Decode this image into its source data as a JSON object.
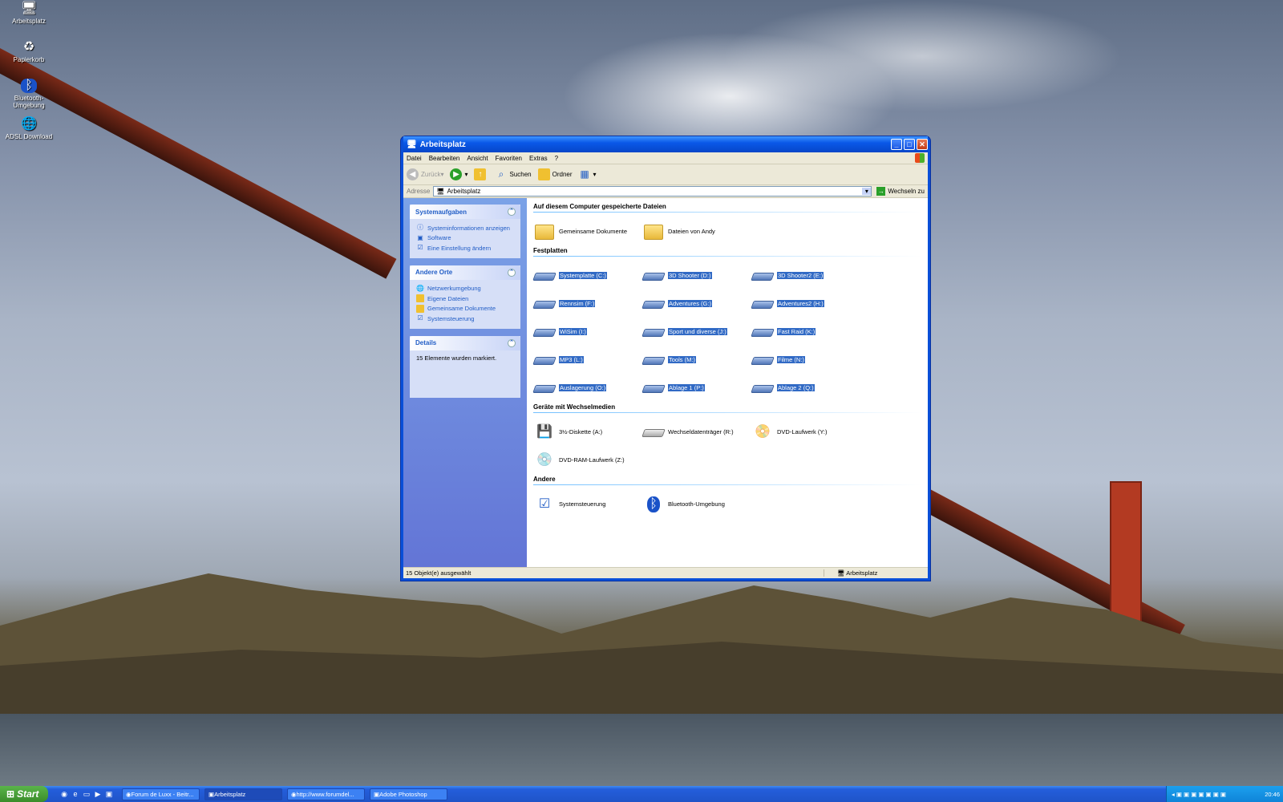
{
  "desktop": {
    "icons": [
      {
        "label": "Arbeitsplatz",
        "icon": "computer-icon"
      },
      {
        "label": "Papierkorb",
        "icon": "recycle-bin-icon"
      },
      {
        "label": "Bluetooth-Umgebung",
        "icon": "bluetooth-icon"
      },
      {
        "label": "ADSL Download",
        "icon": "network-icon"
      }
    ]
  },
  "window": {
    "title": "Arbeitsplatz",
    "menu": [
      "Datei",
      "Bearbeiten",
      "Ansicht",
      "Favoriten",
      "Extras",
      "?"
    ],
    "toolbar": {
      "back": "Zurück",
      "search": "Suchen",
      "folders": "Ordner"
    },
    "address": {
      "label": "Adresse",
      "value": "Arbeitsplatz",
      "go": "Wechseln zu"
    },
    "tasks": {
      "system": {
        "title": "Systemaufgaben",
        "links": [
          "Systeminformationen anzeigen",
          "Software",
          "Eine Einstellung ändern"
        ]
      },
      "other": {
        "title": "Andere Orte",
        "links": [
          "Netzwerkumgebung",
          "Eigene Dateien",
          "Gemeinsame Dokumente",
          "Systemsteuerung"
        ]
      },
      "details": {
        "title": "Details",
        "text": "15 Elemente wurden markiert."
      }
    },
    "groups": {
      "files": {
        "title": "Auf diesem Computer gespeicherte Dateien",
        "items": [
          "Gemeinsame Dokumente",
          "Dateien von Andy"
        ]
      },
      "drives": {
        "title": "Festplatten",
        "items": [
          "Systemplatte (C:)",
          "3D Shooter (D:)",
          "3D Shooter2 (E:)",
          "Rennsim (F:)",
          "Adventures (G:)",
          "Adventures2 (H:)",
          "WiSim (I:)",
          "Sport und diverse (J:)",
          "Fast Raid (K:)",
          "MP3 (L:)",
          "Tools (M:)",
          "Filme (N:)",
          "Auslagerung (O:)",
          "Ablage 1 (P:)",
          "Ablage 2 (Q:)"
        ]
      },
      "removable": {
        "title": "Geräte mit Wechselmedien",
        "items": [
          "3½-Diskette (A:)",
          "Wechseldatenträger (R:)",
          "DVD-Laufwerk (Y:)",
          "DVD-RAM-Laufwerk (Z:)"
        ]
      },
      "other": {
        "title": "Andere",
        "items": [
          "Systemsteuerung",
          "Bluetooth-Umgebung"
        ]
      }
    },
    "status": {
      "left": "15 Objekt(e) ausgewählt",
      "right": "Arbeitsplatz"
    }
  },
  "taskbar": {
    "start": "Start",
    "tasks": [
      "Forum de Luxx - Beitr...",
      "Arbeitsplatz",
      "http://www.forumdel...",
      "Adobe Photoshop"
    ],
    "clock": "20:46"
  }
}
